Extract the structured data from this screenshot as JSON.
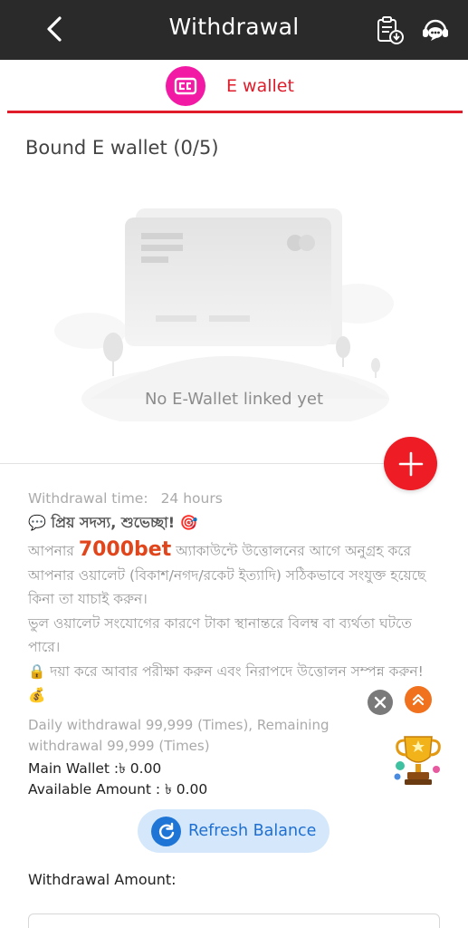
{
  "header": {
    "title": "Withdrawal",
    "back_icon": "chevron-left-icon",
    "records_icon": "clipboard-download-icon",
    "support_icon": "headset-chat-icon"
  },
  "tabs": [
    {
      "label": "E wallet",
      "icon": "wallet-icon",
      "active": true
    }
  ],
  "bound": {
    "title": "Bound E wallet (0/5)",
    "empty_text": "No E-Wallet linked yet"
  },
  "info": {
    "withdrawal_time_label": "Withdrawal time:",
    "withdrawal_time_value": "24 hours",
    "greeting": "💬 প্রিয় সদস্য, শুভেচ্ছা! 🎯",
    "notice_pre": "আপনার ",
    "notice_brand": "7000bet",
    "notice_rest": " অ্যাকাউন্টে উত্তোলনের আগে অনুগ্রহ করে আপনার ওয়ালেট (বিকাশ/নগদ/রকেট ইত্যাদি) সঠিকভাবে সংযুক্ত হয়েছে কিনা তা যাচাই করুন।",
    "notice_line2": "ভুল ওয়ালেট সংযোগের কারণে টাকা স্থানান্তরে বিলম্ব বা ব্যর্থতা ঘটতে পারে।",
    "notice_line3": "🔒 দয়া করে আবার পরীক্ষা করুন এবং নিরাপদে উত্তোলন সম্পন্ন করুন! 💰",
    "daily_limit": "Daily withdrawal 99,999 (Times), Remaining withdrawal 99,999 (Times)",
    "main_wallet": "Main Wallet :৳ 0.00",
    "available_amount": "Available Amount : ৳ 0.00"
  },
  "actions": {
    "refresh_label": "Refresh Balance",
    "add_icon": "plus-icon"
  },
  "form": {
    "amount_label": "Withdrawal Amount:",
    "amount_value": ""
  },
  "colors": {
    "header_bg": "#2a2a2a",
    "accent_red": "#e01c2b",
    "tab_icon_bg": "#f21aa5",
    "refresh_bg": "#d5e8fb",
    "refresh_blue": "#1f75d6",
    "brand_orange": "#e0451b"
  }
}
